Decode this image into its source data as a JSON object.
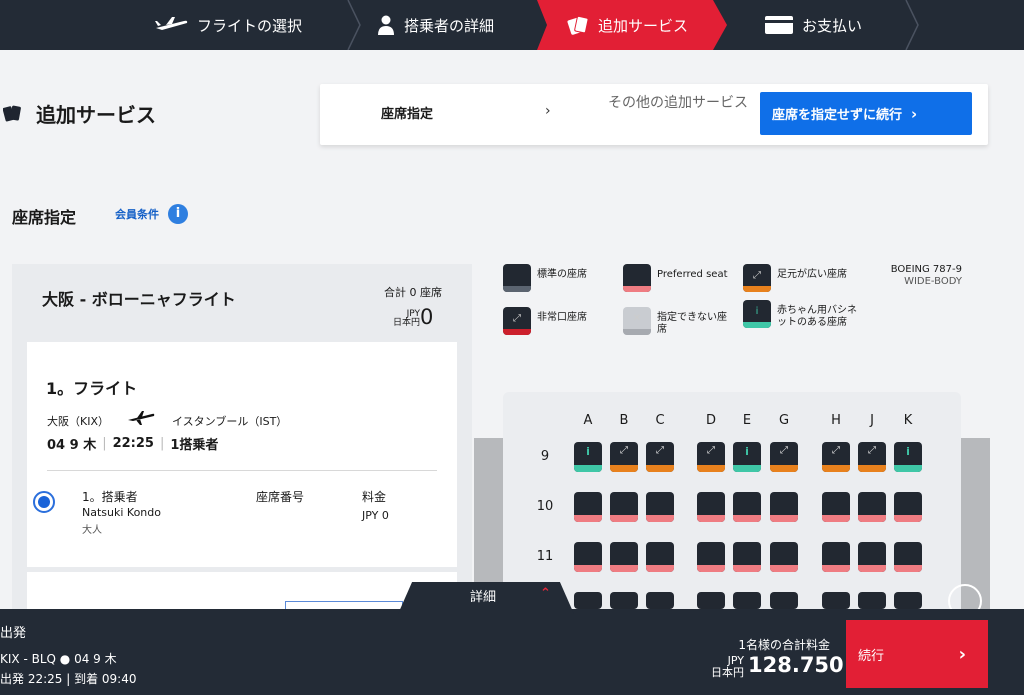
{
  "steps": [
    {
      "label": "フライトの選択",
      "icon": "plane-icon"
    },
    {
      "label": "搭乗者の詳細",
      "icon": "person-icon"
    },
    {
      "label": "追加サービス",
      "icon": "cards-icon"
    },
    {
      "label": "お支払い",
      "icon": "credit-card-icon"
    }
  ],
  "colors": {
    "nav_bg": "#232b36",
    "accent_red": "#e21f35",
    "primary_blue": "#0f6fe8",
    "seat_dark": "#222831",
    "legroom_orange": "#e8811d",
    "bassinet_green": "#3fc7a7",
    "exit_red": "#cc1f2c",
    "unavailable_grey": "#a7aab0",
    "preferred_pink": "#ef7c82"
  },
  "page": {
    "title": "追加サービス"
  },
  "tabs": {
    "seat": "座席指定",
    "chevron": "›",
    "other": "その他の追加サービス",
    "skip_button": "座席を指定せずに続行"
  },
  "section": {
    "title": "座席指定",
    "member_link": "会員条件",
    "info": "i"
  },
  "flight_summary": {
    "route": "大阪 - ボローニャフライト",
    "total_seats": "合計 0 座席",
    "currency_code": "JPY",
    "currency_name": "日本円",
    "total_value": "0"
  },
  "flight": {
    "heading": "1。フライト",
    "from": "大阪（KIX）",
    "to": "イスタンブール（IST）",
    "date": "04 9 木",
    "time": "22:25",
    "passengers": "1搭乗者"
  },
  "passenger": {
    "header": "1。搭乗者",
    "name": "Natsuki Kondo",
    "type": "大人",
    "seat_header": "座席番号",
    "fee_header": "料金",
    "fee_value": "JPY  0"
  },
  "legend": [
    {
      "label": "標準の座席",
      "type": "standard"
    },
    {
      "label": "Preferred seat",
      "type": "preferred"
    },
    {
      "label": "足元が広い座席",
      "type": "legroom"
    },
    {
      "label": "非常口座席",
      "type": "exit"
    },
    {
      "label": "指定できない座席",
      "type": "unavailable"
    },
    {
      "label": "赤ちゃん用バシネットのある座席",
      "type": "bassinet"
    }
  ],
  "aircraft": {
    "model": "BOEING 787-9",
    "body": "WIDE-BODY"
  },
  "seat_map": {
    "columns": [
      "A",
      "B",
      "C",
      "D",
      "E",
      "G",
      "H",
      "J",
      "K"
    ],
    "rows": [
      {
        "number": "9",
        "seats": [
          "bassinet",
          "legroom",
          "legroom",
          "legroom",
          "bassinet",
          "legroom",
          "legroom",
          "legroom",
          "bassinet"
        ]
      },
      {
        "number": "10",
        "seats": [
          "preferred",
          "preferred",
          "preferred",
          "preferred",
          "preferred",
          "preferred",
          "preferred",
          "preferred",
          "preferred"
        ]
      },
      {
        "number": "11",
        "seats": [
          "preferred",
          "preferred",
          "preferred",
          "preferred",
          "preferred",
          "preferred",
          "preferred",
          "preferred",
          "preferred"
        ]
      },
      {
        "number": "",
        "seats": [
          "standard",
          "standard",
          "standard",
          "standard",
          "standard",
          "standard",
          "standard",
          "standard",
          "standard"
        ]
      }
    ]
  },
  "footer": {
    "details": "詳細",
    "departure": "出発",
    "route": "KIX - BLQ",
    "date": "04 9 木",
    "times": "出発 22:25 | 到着 09:40",
    "total_label": "1名様の合計料金",
    "currency_code": "JPY",
    "currency_name": "日本円",
    "price": "128.750",
    "continue": "続行"
  }
}
